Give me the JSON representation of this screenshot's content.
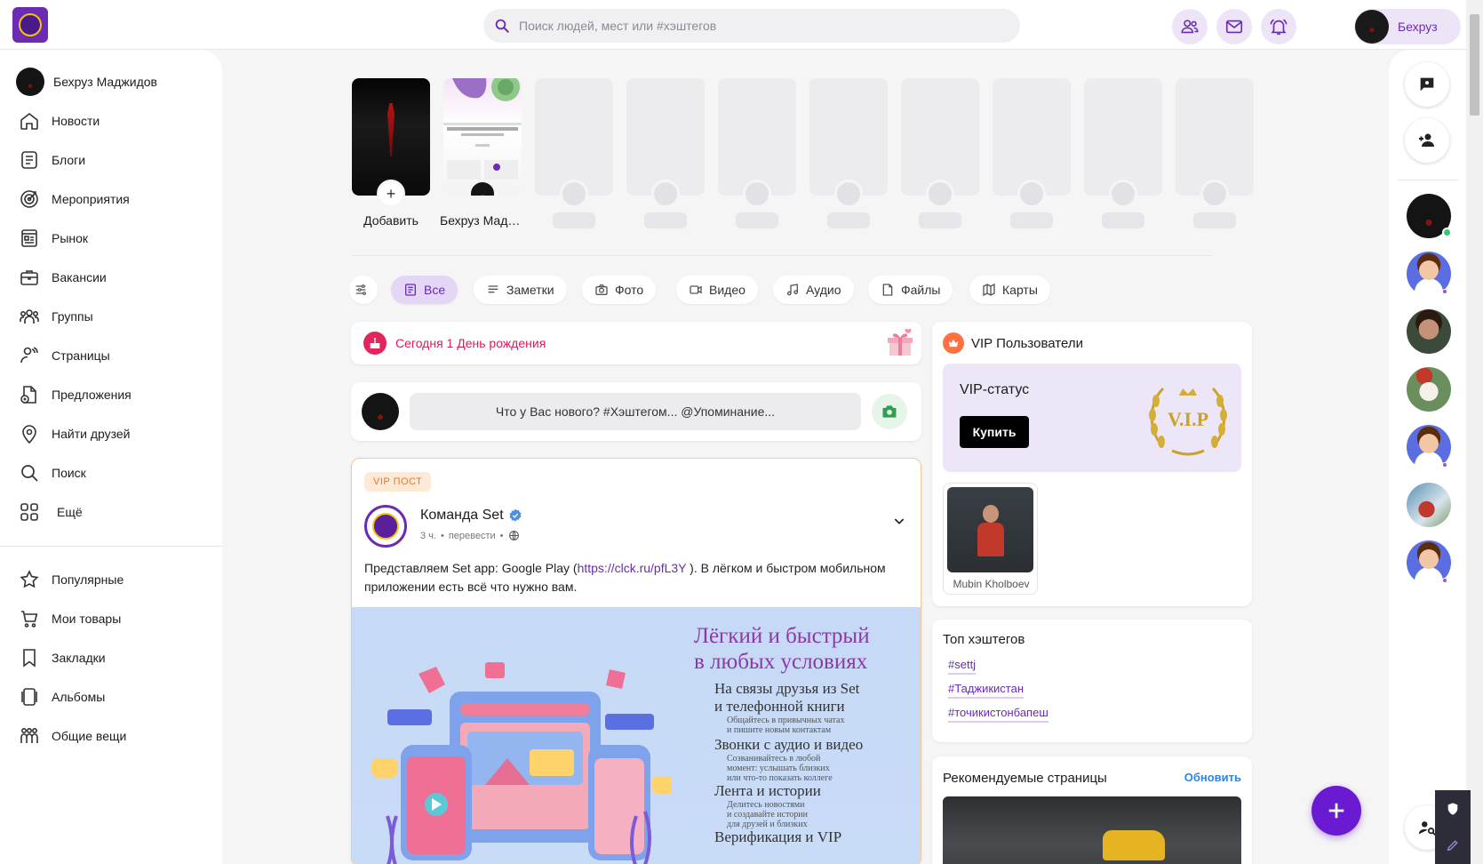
{
  "search": {
    "placeholder": "Поиск людей, мест или #хэштегов"
  },
  "header": {
    "user_name": "Бехруз"
  },
  "sidebar": {
    "profile_name": "Бехруз Маджидов",
    "items": [
      {
        "label": "Новости",
        "icon": "home-icon"
      },
      {
        "label": "Блоги",
        "icon": "document-icon"
      },
      {
        "label": "Мероприятия",
        "icon": "target-icon"
      },
      {
        "label": "Рынок",
        "icon": "store-icon"
      },
      {
        "label": "Вакансии",
        "icon": "briefcase-icon"
      },
      {
        "label": "Группы",
        "icon": "group-icon"
      },
      {
        "label": "Страницы",
        "icon": "pages-icon"
      },
      {
        "label": "Предложения",
        "icon": "offers-icon"
      },
      {
        "label": "Найти друзей",
        "icon": "location-icon"
      },
      {
        "label": "Поиск",
        "icon": "search-icon"
      },
      {
        "label": "Ещё",
        "icon": "grid-icon"
      }
    ],
    "items2": [
      {
        "label": "Популярные",
        "icon": "star-icon"
      },
      {
        "label": "Мои товары",
        "icon": "cart-icon"
      },
      {
        "label": "Закладки",
        "icon": "bookmark-icon"
      },
      {
        "label": "Альбомы",
        "icon": "album-icon"
      },
      {
        "label": "Общие вещи",
        "icon": "people-icon"
      }
    ]
  },
  "stories": {
    "add_label": "Добавить",
    "user_label": "Бехруз Маджидов"
  },
  "filters": [
    "Все",
    "Заметки",
    "Фото",
    "Видео",
    "Аудио",
    "Файлы",
    "Карты"
  ],
  "birthday": {
    "text": "Сегодня 1 День рождения"
  },
  "composer": {
    "placeholder": "Что у Вас нового? #Хэштегом... @Упоминание..."
  },
  "post": {
    "tag": "VIP ПОСТ",
    "author": "Команда Set",
    "time": "3 ч.",
    "translate": "перевести",
    "text_before": "Представляем Set app: Google Play (",
    "link": "https://clck.ru/pfL3Y",
    "text_after": " ). В лёгком и быстром мобильном приложении есть всё что нужно вам.",
    "promo_title_1": "Лёгкий и быстрый",
    "promo_title_2": "в любых условиях",
    "features": [
      {
        "h1": "На связы друзья из Set",
        "h2": "и телефонной книги",
        "s": [
          "Общайтесь в привычных чатах",
          "и пишите новым контактам"
        ]
      },
      {
        "h1": "Звонки с аудио и видео",
        "h2": "",
        "s": [
          "Созванивайтесь в любой",
          "момент: услышать близких",
          "или что-то показать коллеге"
        ]
      },
      {
        "h1": "Лента и истории",
        "h2": "",
        "s": [
          "Делитесь новостями",
          "и создавайте истории",
          "для друзей и близких"
        ]
      },
      {
        "h1": "Верификация и VIP",
        "h2": "",
        "s": []
      }
    ]
  },
  "vip": {
    "title": "VIP Пользователи",
    "status": "VIP-статус",
    "buy": "Купить",
    "badge": "V.I.P",
    "user_name": "Mubin Kholboev"
  },
  "hashtags": {
    "title": "Топ хэштегов",
    "tags": [
      "#settj",
      "#Таджикистан",
      "#точикистонбапеш"
    ]
  },
  "recommended": {
    "title": "Рекомендуемые страницы",
    "refresh": "Обновить"
  },
  "colors": {
    "accent": "#6b2bb3",
    "fab": "#6a1bd1",
    "birthday": "#d81b60",
    "link": "#2e86de"
  }
}
